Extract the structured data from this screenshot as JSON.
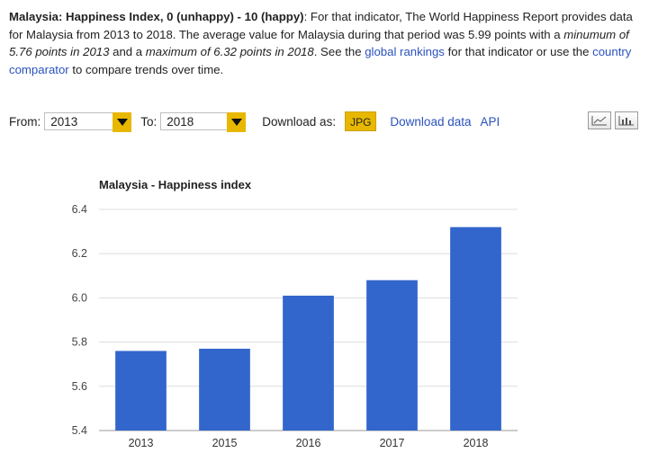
{
  "intro": {
    "title": "Malaysia: Happiness Index, 0 (unhappy) - 10 (happy)",
    "t1": ": For that indicator, The World Happiness Report provides data for Malaysia from 2013 to 2018. The average value for Malaysia during that period was 5.99 points with a ",
    "t2": "minumum of 5.76 points in 2013",
    "t3": " and a ",
    "t4": "maximum of 6.32 points in 2018",
    "t5": ". See the ",
    "link1": "global rankings",
    "t6": " for that indicator or use the ",
    "link2": "country comparator",
    "t7": " to compare trends over time."
  },
  "controls": {
    "from_label": "From:",
    "from_value": "2013",
    "to_label": "To:",
    "to_value": "2018",
    "download_label": "Download as:",
    "jpg_label": "JPG",
    "download_data": "Download data",
    "api": "API"
  },
  "icons": {
    "line_chart": "line-chart-icon",
    "bar_chart": "bar-chart-icon",
    "dropdown": "chevron-down-icon"
  },
  "colors": {
    "bar": "#3366cc",
    "accent": "#e8b800",
    "link": "#2a52be",
    "grid": "#dddddd"
  },
  "chart_data": {
    "type": "bar",
    "title": "Malaysia - Happiness index",
    "categories": [
      "2013",
      "2015",
      "2016",
      "2017",
      "2018"
    ],
    "values": [
      5.76,
      5.77,
      6.01,
      6.08,
      6.32
    ],
    "xlabel": "",
    "ylabel": "",
    "ylim": [
      5.4,
      6.4
    ],
    "yticks": [
      "5.4",
      "5.6",
      "5.8",
      "6.0",
      "6.2",
      "6.4"
    ],
    "grid": true,
    "legend": "none"
  }
}
